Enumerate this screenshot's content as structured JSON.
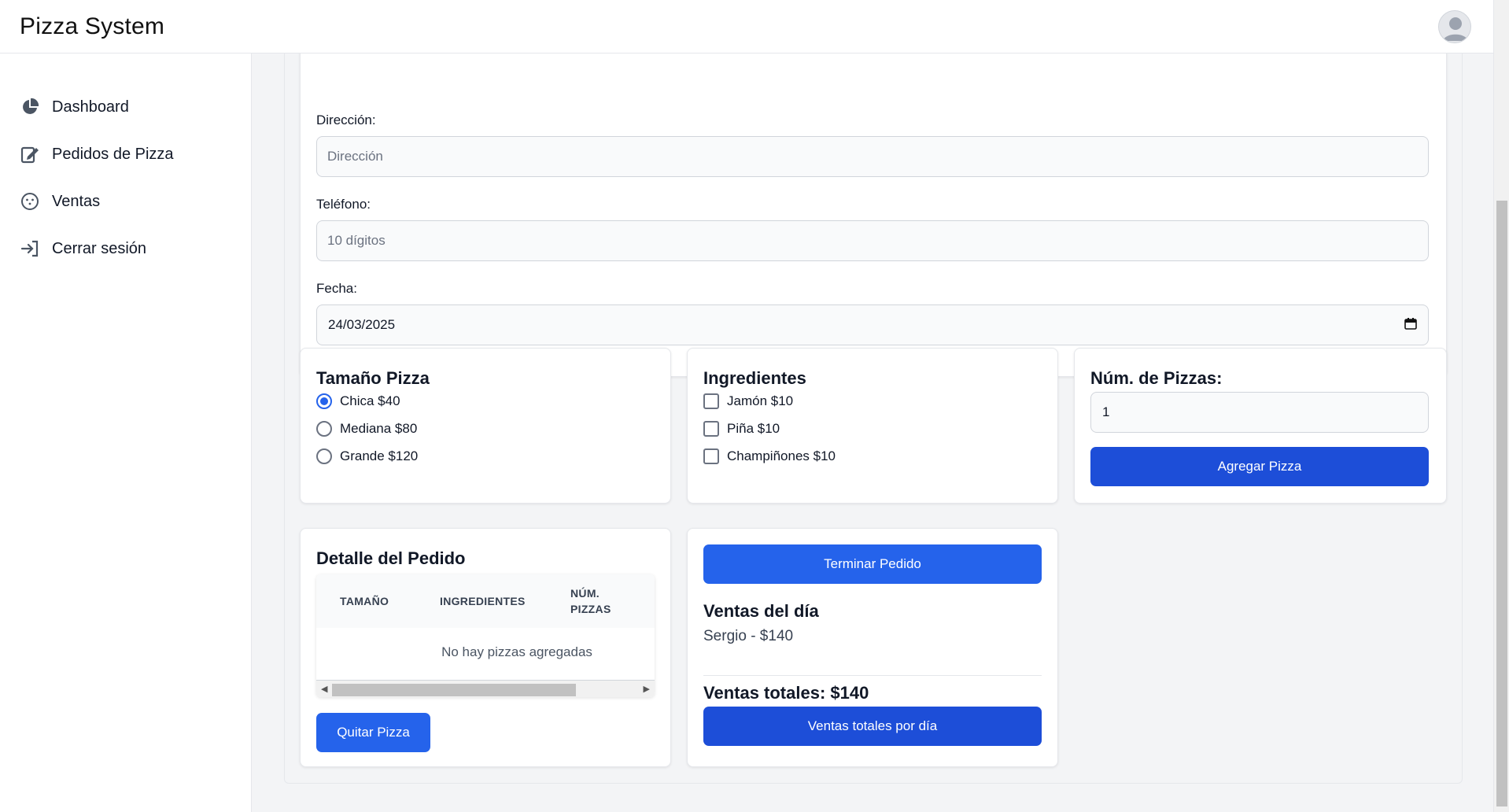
{
  "header": {
    "title": "Pizza System",
    "avatar_icon": "user-avatar-icon"
  },
  "sidebar": {
    "items": [
      {
        "label": "Dashboard",
        "icon": "pie-chart-icon"
      },
      {
        "label": "Pedidos de Pizza",
        "icon": "edit-document-icon"
      },
      {
        "label": "Ventas",
        "icon": "smile-icon"
      },
      {
        "label": "Cerrar sesión",
        "icon": "logout-icon"
      }
    ]
  },
  "form": {
    "address_label": "Dirección:",
    "address_placeholder": "Dirección",
    "phone_label": "Teléfono:",
    "phone_placeholder": "10 dígitos",
    "date_label": "Fecha:",
    "date_value": "24/03/2025"
  },
  "size_card": {
    "title": "Tamaño Pizza",
    "options": [
      {
        "label": "Chica $40",
        "selected": true
      },
      {
        "label": "Mediana $80",
        "selected": false
      },
      {
        "label": "Grande $120",
        "selected": false
      }
    ]
  },
  "ingredients_card": {
    "title": "Ingredientes",
    "options": [
      {
        "label": "Jamón $10",
        "checked": false
      },
      {
        "label": "Piña $10",
        "checked": false
      },
      {
        "label": "Champiñones $10",
        "checked": false
      }
    ]
  },
  "quantity_card": {
    "title": "Núm. de Pizzas:",
    "value": "1",
    "add_button": "Agregar Pizza"
  },
  "order_detail": {
    "title": "Detalle del Pedido",
    "columns": [
      "TAMAÑO",
      "INGREDIENTES",
      "NÚM.",
      "PIZZAS"
    ],
    "empty_text": "No hay pizzas agregadas",
    "remove_button": "Quitar Pizza"
  },
  "sales": {
    "finish_button": "Terminar Pedido",
    "daily_title": "Ventas del día",
    "entry": "Sergio - $140",
    "total_text": "Ventas totales: $140",
    "daily_totals_button": "Ventas totales por día"
  },
  "colors": {
    "primary": "#2563eb",
    "primary_dark": "#1d4ed8",
    "background": "#f3f4f6"
  }
}
